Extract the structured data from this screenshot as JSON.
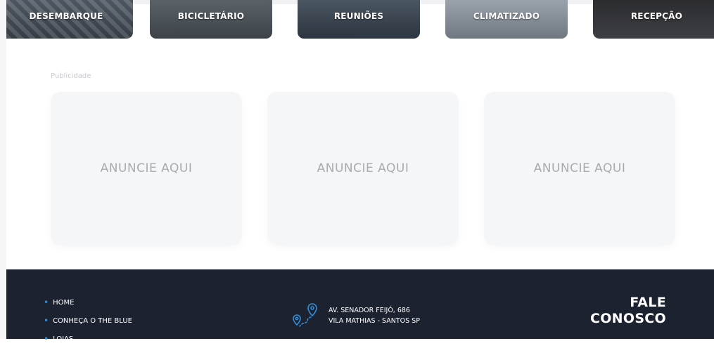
{
  "features": [
    {
      "label": "DESEMBARQUE"
    },
    {
      "label": "BICICLETÁRIO"
    },
    {
      "label": "REUNIÕES"
    },
    {
      "label": "CLIMATIZADO"
    },
    {
      "label": "RECEPÇÃO"
    }
  ],
  "ads": {
    "caption": "Publicidade",
    "cards": [
      {
        "text": "ANUNCIE AQUI"
      },
      {
        "text": "ANUNCIE AQUI"
      },
      {
        "text": "ANUNCIE AQUI"
      }
    ]
  },
  "footer": {
    "nav": [
      {
        "label": "HOME"
      },
      {
        "label": "CONHEÇA O THE BLUE"
      },
      {
        "label": "LOJAS"
      }
    ],
    "address": {
      "icon": "map-route-icon",
      "line1": "AV. SENADOR FEIJÓ, 686",
      "line2": "VILA MATHIAS - SANTOS SP"
    },
    "contact": {
      "line1": "FALE",
      "line2": "CONOSCO"
    }
  },
  "colors": {
    "footer_bg": "#1d2231",
    "accent": "#2f8fd8",
    "card_bg": "#f5f6f8",
    "ad_text": "#a9abb0"
  }
}
